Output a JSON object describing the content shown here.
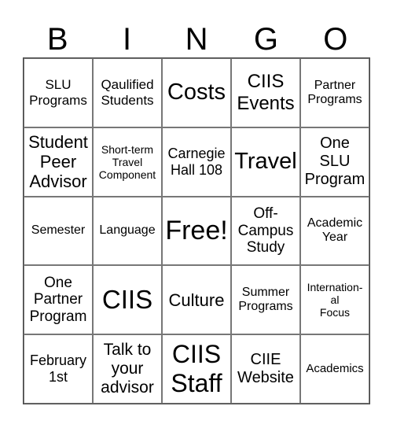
{
  "header": [
    "B",
    "I",
    "N",
    "G",
    "O"
  ],
  "cells": [
    {
      "text": "SLU\nPrograms",
      "size": 17
    },
    {
      "text": "Qaulified\nStudents",
      "size": 17
    },
    {
      "text": "Costs",
      "size": 29
    },
    {
      "text": "CIIS\nEvents",
      "size": 24
    },
    {
      "text": "Partner\nPrograms",
      "size": 16
    },
    {
      "text": "Student\nPeer\nAdvisor",
      "size": 22
    },
    {
      "text": "Short-term\nTravel\nComponent",
      "size": 14
    },
    {
      "text": "Carnegie\nHall 108",
      "size": 18
    },
    {
      "text": "Travel",
      "size": 29
    },
    {
      "text": "One\nSLU\nProgram",
      "size": 20
    },
    {
      "text": "Semester",
      "size": 16
    },
    {
      "text": "Language",
      "size": 16
    },
    {
      "text": "Free!",
      "size": 34
    },
    {
      "text": "Off-\nCampus\nStudy",
      "size": 19
    },
    {
      "text": "Academic\nYear",
      "size": 16
    },
    {
      "text": "One\nPartner\nProgram",
      "size": 19
    },
    {
      "text": "CIIS",
      "size": 33
    },
    {
      "text": "Culture",
      "size": 22
    },
    {
      "text": "Summer\nPrograms",
      "size": 16
    },
    {
      "text": "Internation-\nal\nFocus",
      "size": 14
    },
    {
      "text": "February\n1st",
      "size": 18
    },
    {
      "text": "Talk to\nyour\nadvisor",
      "size": 21
    },
    {
      "text": "CIIS\nStaff",
      "size": 32
    },
    {
      "text": "CIIE\nWebsite",
      "size": 20
    },
    {
      "text": "Academics",
      "size": 15
    }
  ]
}
